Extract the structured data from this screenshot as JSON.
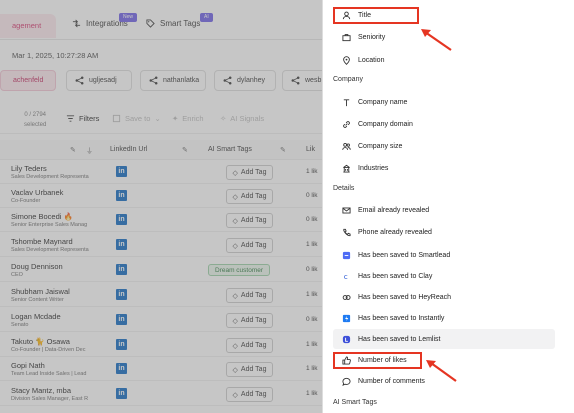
{
  "nav": {
    "active_tab": "agement",
    "integrations": "Integrations",
    "integrations_badge": "New",
    "smart_tags": "Smart Tags",
    "smart_tags_badge": "AI"
  },
  "timestamp": "Mar 1, 2025, 10:27:28 AM",
  "chips": [
    "achenfeld",
    "ugljesadj",
    "nathanlatka",
    "dylanhey",
    "wesb"
  ],
  "toolbar": {
    "selected_count": "0 / 2794",
    "selected_label": "selected",
    "filters": "Filters",
    "save_to": "Save to",
    "enrich": "Enrich",
    "ai_signals": "AI Signals"
  },
  "columns": {
    "linkedin": "LinkedIn Url",
    "smart_tags": "AI Smart Tags",
    "likes": "Lik"
  },
  "rows": [
    {
      "name": "Lily Teders",
      "title": "Sales Development Representa",
      "tag": "Add Tag",
      "likes": "1 lik"
    },
    {
      "name": "Vaclav Urbanek",
      "title": "Co-Founder",
      "tag": "Add Tag",
      "likes": "0 lik"
    },
    {
      "name": "Simone Bocedi 🔥",
      "title": "Senior Enterprise Sales Manag",
      "tag": "Add Tag",
      "likes": "0 lik"
    },
    {
      "name": "Tshombe Maynard",
      "title": "Sales Development Representa",
      "tag": "Add Tag",
      "likes": "1 lik"
    },
    {
      "name": "Doug Dennison",
      "title": "CEO",
      "tag": "Dream customer",
      "likes": "0 lik"
    },
    {
      "name": "Shubham Jaiswal",
      "title": "Senior Content Writer",
      "tag": "Add Tag",
      "likes": "1 lik"
    },
    {
      "name": "Logan Mcdade",
      "title": "Senato",
      "tag": "Add Tag",
      "likes": "0 lik"
    },
    {
      "name": "Takuto 🐈 Osawa",
      "title": "Co-Founder | Data-Driven Dec",
      "tag": "Add Tag",
      "likes": "1 lik"
    },
    {
      "name": "Gopi Nath",
      "title": "Team Lead Inside Sales | Lead",
      "tag": "Add Tag",
      "likes": "1 lik"
    },
    {
      "name": "Stacy Mantz, mba",
      "title": "Division Sales Manager, East R",
      "tag": "Add Tag",
      "likes": "1 lik"
    }
  ],
  "panel": {
    "person_items": [
      {
        "label": "Title",
        "icon": "person-icon"
      },
      {
        "label": "Seniority",
        "icon": "briefcase-icon"
      },
      {
        "label": "Location",
        "icon": "location-pin-icon"
      }
    ],
    "company_section": "Company",
    "company_items": [
      {
        "label": "Company name",
        "icon": "text-icon"
      },
      {
        "label": "Company domain",
        "icon": "link-icon"
      },
      {
        "label": "Company size",
        "icon": "people-icon"
      },
      {
        "label": "Industries",
        "icon": "building-icon"
      }
    ],
    "details_section": "Details",
    "details_items": [
      {
        "label": "Email already revealed",
        "icon": "mail-icon"
      },
      {
        "label": "Phone already revealed",
        "icon": "phone-icon"
      },
      {
        "label": "Has been saved to Smartlead",
        "icon": "smartlead-icon"
      },
      {
        "label": "Has been saved to Clay",
        "icon": "clay-icon"
      },
      {
        "label": "Has been saved to HeyReach",
        "icon": "heyreach-icon"
      },
      {
        "label": "Has been saved to Instantly",
        "icon": "instantly-icon"
      },
      {
        "label": "Has been saved to Lemlist",
        "icon": "lemlist-icon"
      },
      {
        "label": "Number of likes",
        "icon": "thumbs-up-icon"
      },
      {
        "label": "Number of comments",
        "icon": "comment-icon"
      }
    ],
    "ai_section": "AI Smart Tags"
  },
  "colors": {
    "accent": "#d6336c",
    "linkedin": "#0a66c2",
    "annotation": "#e53522"
  }
}
